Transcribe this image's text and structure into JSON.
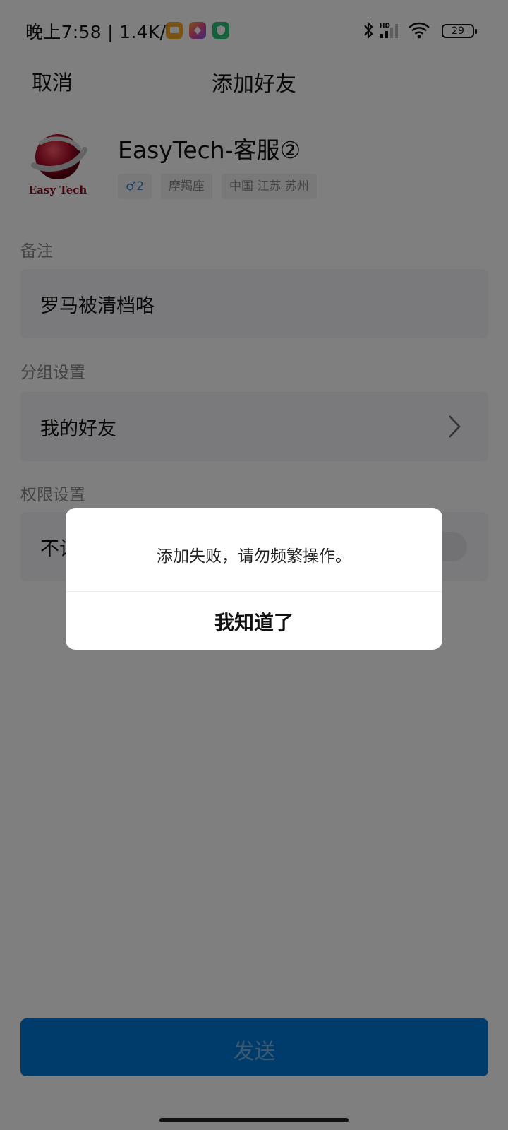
{
  "status_bar": {
    "time": "晚上7:58 | 1.4K/s",
    "app_icons": [
      {
        "name": "message-app-icon",
        "color": "#f7a928"
      },
      {
        "name": "browser-app-icon",
        "color": "#e84a8f"
      },
      {
        "name": "security-app-icon",
        "color": "#2bc37a"
      }
    ],
    "battery": "29"
  },
  "header": {
    "cancel_label": "取消",
    "title": "添加好友"
  },
  "profile": {
    "name": "EasyTech-客服②",
    "tags": [
      "♂2",
      "摩羯座",
      "中国 江苏 苏州"
    ],
    "gender_color": "#3a7bd5"
  },
  "remark": {
    "label": "备注",
    "value": "罗马被清档咯"
  },
  "group": {
    "label": "分组设置",
    "value": "我的好友"
  },
  "permission": {
    "label": "权限设置",
    "value_visible": "不让他看我"
  },
  "send_button": {
    "label": "发送",
    "color": "#0078d7"
  },
  "dialog": {
    "message": "添加失败，请勿频繁操作。",
    "confirm_label": "我知道了"
  }
}
